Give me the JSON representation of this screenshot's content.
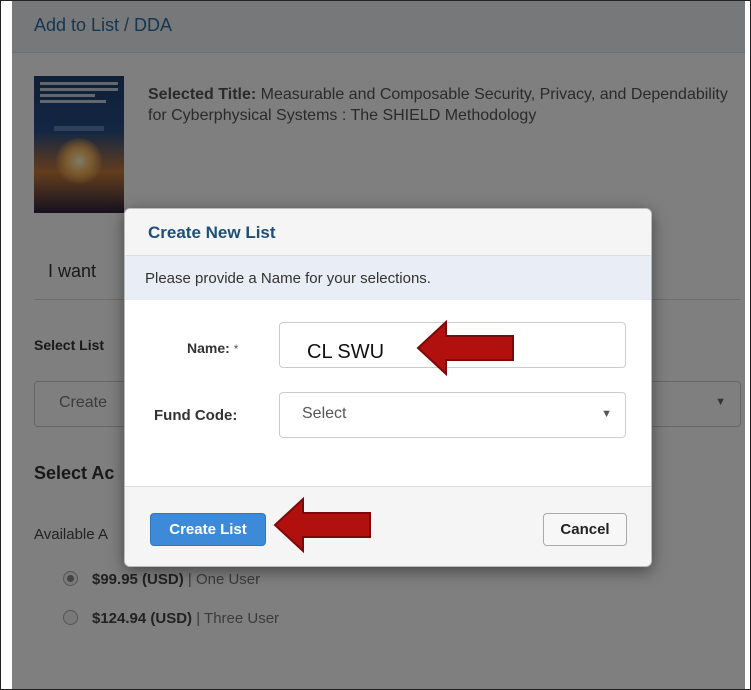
{
  "panel": {
    "title": "Add to List / DDA",
    "selected_title_label": "Selected Title:",
    "selected_title_value": " Measurable and Composable Security, Privacy, and Dependability for Cyberphysical Systems : The SHIELD Methodology",
    "i_want_text": "I want",
    "select_list_label": "Select List",
    "list_select_value": "Create",
    "select_access_label": "Select Ac",
    "available_label": "Available A",
    "prices": [
      {
        "amount": "$99.95 (USD)",
        "separator": " | ",
        "label": "One User",
        "selected": true
      },
      {
        "amount": "$124.94 (USD)",
        "separator": " | ",
        "label": "Three User",
        "selected": false
      }
    ]
  },
  "modal": {
    "title": "Create New List",
    "instruction": "Please provide a Name for your selections.",
    "name_label": "Name:",
    "required_mark": "*",
    "name_value": "CL SWU",
    "fund_code_label": "Fund Code:",
    "fund_code_value": "Select",
    "create_button": "Create List",
    "cancel_button": "Cancel"
  },
  "icons": {
    "dropdown": "chevron-down-icon",
    "annotation": "red-arrow-icon"
  },
  "colors": {
    "accent": "#3d8bd8",
    "title_blue": "#1f4e79",
    "annotation_red": "#b20f0f"
  }
}
